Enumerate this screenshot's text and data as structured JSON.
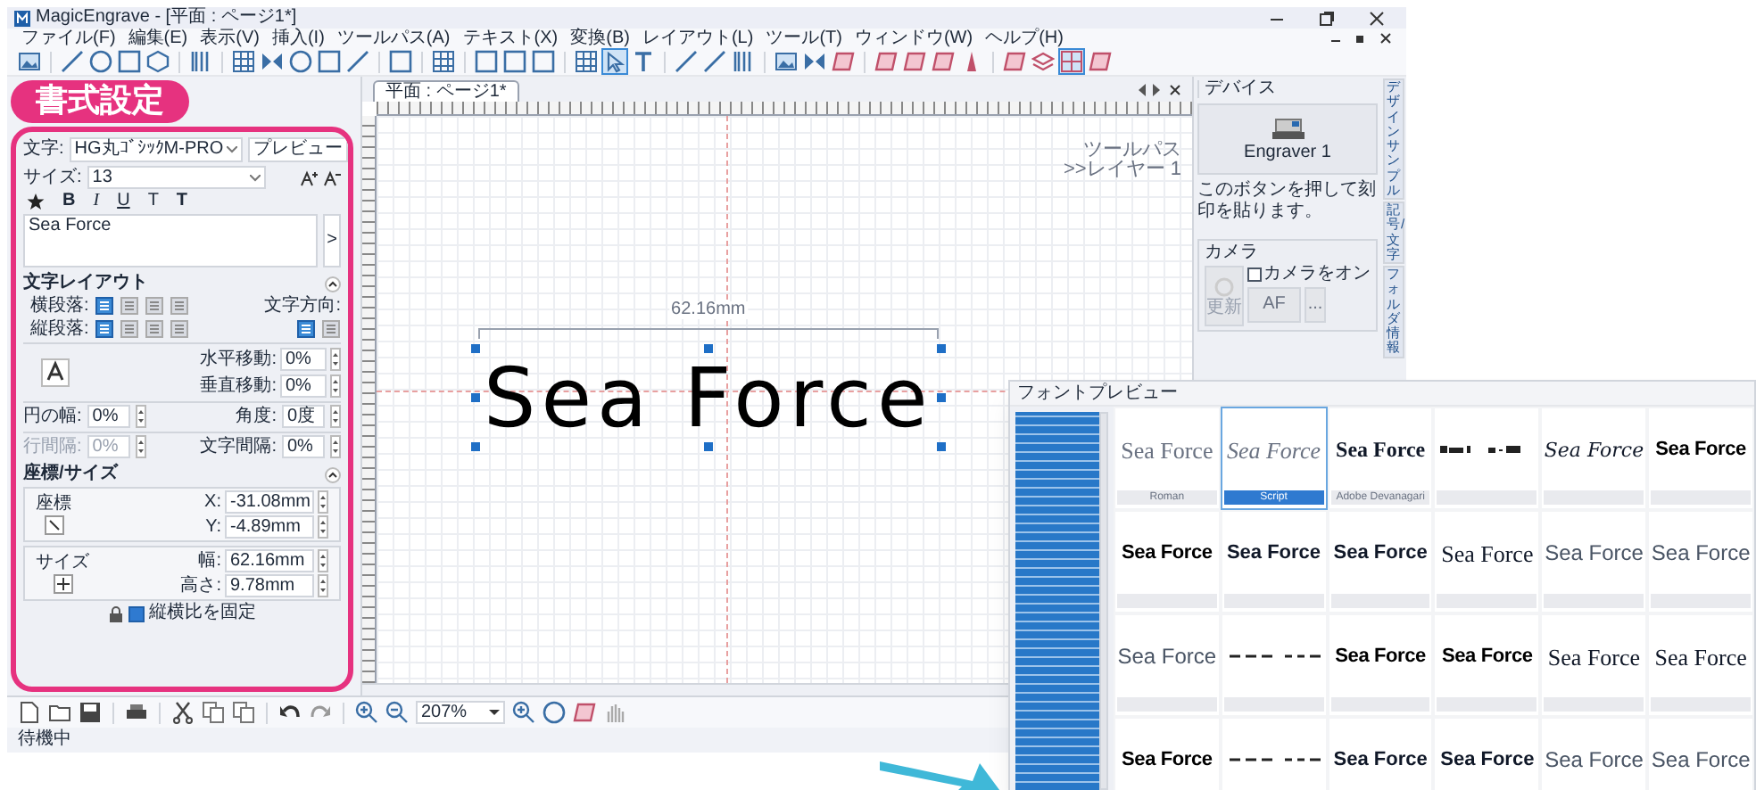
{
  "window": {
    "title": "MagicEngrave - [平面 : ページ1*]"
  },
  "menu": [
    "ファイル(F)",
    "編集(E)",
    "表示(V)",
    "挿入(I)",
    "ツールパス(A)",
    "テキスト(X)",
    "変換(B)",
    "レイアウト(L)",
    "ツール(T)",
    "ウィンドウ(W)",
    "ヘルプ(H)"
  ],
  "callout": {
    "label": "書式設定"
  },
  "format_panel": {
    "font_label": "文字:",
    "font": "HG丸ｺﾞｼｯｸM-PRO",
    "preview_button": "プレビュー",
    "size_label": "サイズ:",
    "size": "13",
    "style_buttons": [
      "B",
      "I",
      "U",
      "T",
      "T"
    ],
    "text": "Sea Force",
    "expand_button": ">",
    "layout_section": "文字レイアウト",
    "h_align_label": "横段落:",
    "h_align": [
      {
        "selected": true
      },
      {
        "selected": false
      },
      {
        "selected": false
      },
      {
        "selected": false
      }
    ],
    "direction_label": "文字方向:",
    "direction": [
      {
        "selected": true
      },
      {
        "selected": false
      }
    ],
    "v_align_label": "縦段落:",
    "v_align": [
      {
        "selected": true
      },
      {
        "selected": false
      },
      {
        "selected": false
      },
      {
        "selected": false
      }
    ],
    "offsets": [
      {
        "label": "水平移動:",
        "value": "0%"
      },
      {
        "label": "垂直移動:",
        "value": "0%"
      }
    ],
    "spacing": [
      {
        "label": "円の幅:",
        "value": "0%",
        "disabled": false
      },
      {
        "label": "角度:",
        "value": "0度",
        "disabled": false
      },
      {
        "label": "行間隔:",
        "value": "0%",
        "disabled": true
      },
      {
        "label": "文字間隔:",
        "value": "0%",
        "disabled": false
      }
    ],
    "position_section": "座標/サイズ",
    "position": {
      "label": "座標",
      "fields": [
        {
          "label": "X:",
          "value": "-31.08mm"
        },
        {
          "label": "Y:",
          "value": "-4.89mm"
        }
      ]
    },
    "size_group": {
      "label": "サイズ",
      "fields": [
        {
          "label": "幅:",
          "value": "62.16mm"
        },
        {
          "label": "高さ:",
          "value": "9.78mm"
        }
      ]
    },
    "aspect_lock": {
      "label": "縦横比を固定",
      "checked": true
    }
  },
  "document_tab": {
    "label": "平面 : ページ1*",
    "selected": true
  },
  "canvas": {
    "layer_lines": [
      "ツールパス",
      ">>レイヤー 1"
    ],
    "dimension": "62.16mm",
    "text": "Sea Force"
  },
  "device_panel": {
    "title": "デバイス",
    "device": "Engraver 1",
    "hint": "このボタンを押して刻印を貼ります。",
    "camera_group": "カメラ",
    "refresh_button": {
      "label": "更新",
      "disabled": true
    },
    "camera_on": {
      "label": "カメラをオン",
      "checked": false
    },
    "af_button": "AF",
    "more_button": "..."
  },
  "side_tabs": [
    "デザインサンプル",
    "記号/文字",
    "フォルダ情報"
  ],
  "zoom": "207%",
  "status_bar": "待機中",
  "font_preview": {
    "title": "フォントプレビュー",
    "samples": [
      {
        "kind": "serif-light",
        "text": "Sea Force",
        "caption": "Roman",
        "selected": false
      },
      {
        "kind": "script",
        "text": "Sea Force",
        "caption": "Script",
        "selected": true
      },
      {
        "kind": "serif-bold",
        "text": "Sea Force",
        "caption": "Adobe Devanagari",
        "selected": false
      },
      {
        "kind": "barcode",
        "selected": false
      },
      {
        "kind": "brush",
        "text": "Sea Force",
        "selected": false
      },
      {
        "kind": "sans-heavy",
        "text": "Sea Force",
        "selected": false
      },
      {
        "kind": "sans-heavy",
        "text": "Sea Force",
        "selected": false
      },
      {
        "kind": "sans-bold",
        "text": "Sea Force",
        "selected": false
      },
      {
        "kind": "sans-bold",
        "text": "Sea Force",
        "selected": false
      },
      {
        "kind": "serif",
        "text": "Sea Force",
        "selected": false
      },
      {
        "kind": "sans-light",
        "text": "Sea Force",
        "selected": false
      },
      {
        "kind": "sans-light",
        "text": "Sea Force",
        "selected": false
      },
      {
        "kind": "sans-light",
        "text": "Sea Force",
        "selected": false
      },
      {
        "kind": "symbol",
        "selected": false
      },
      {
        "kind": "sans-heavy",
        "text": "Sea Force",
        "selected": false
      },
      {
        "kind": "sans-heavy",
        "text": "Sea Force",
        "selected": false
      },
      {
        "kind": "serif",
        "text": "Sea Force",
        "selected": false
      },
      {
        "kind": "serif",
        "text": "Sea Force",
        "selected": false
      },
      {
        "kind": "sans-heavy",
        "text": "Sea Force",
        "selected": false
      },
      {
        "kind": "symbol",
        "selected": false
      },
      {
        "kind": "sans-bold",
        "text": "Sea Force",
        "selected": false
      },
      {
        "kind": "sans-bold",
        "text": "Sea Force",
        "selected": false
      },
      {
        "kind": "sans-light",
        "text": "Sea Force",
        "selected": false
      },
      {
        "kind": "sans-light",
        "text": "Sea Force",
        "selected": false
      }
    ]
  }
}
